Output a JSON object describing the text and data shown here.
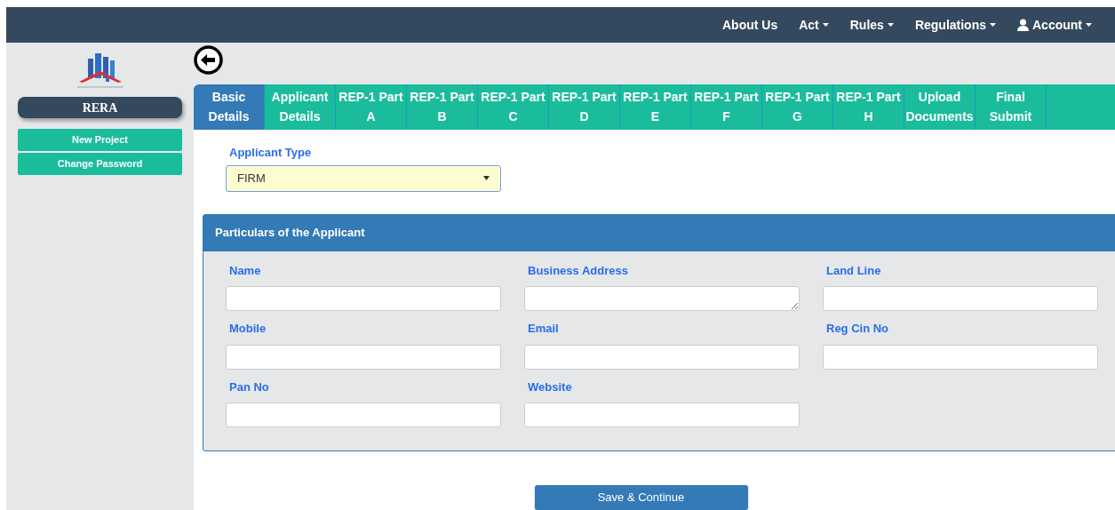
{
  "navbar": {
    "items": [
      {
        "label": "About Us",
        "dropdown": false,
        "kind": "link"
      },
      {
        "label": "Act",
        "dropdown": true,
        "kind": "link"
      },
      {
        "label": "Rules",
        "dropdown": true,
        "kind": "link"
      },
      {
        "label": "Regulations",
        "dropdown": true,
        "kind": "link"
      },
      {
        "label": "Account",
        "dropdown": true,
        "kind": "account"
      }
    ]
  },
  "sidebar": {
    "title": "RERA",
    "items": [
      {
        "label": "New Project"
      },
      {
        "label": "Change Password"
      }
    ]
  },
  "tabs": [
    {
      "line1": "Basic",
      "line2": "Details",
      "selected": true
    },
    {
      "line1": "Applicant",
      "line2": "Details",
      "selected": false
    },
    {
      "line1": "REP-1 Part",
      "line2": "A",
      "selected": false
    },
    {
      "line1": "REP-1 Part",
      "line2": "B",
      "selected": false
    },
    {
      "line1": "REP-1 Part",
      "line2": "C",
      "selected": false
    },
    {
      "line1": "REP-1 Part",
      "line2": "D",
      "selected": false
    },
    {
      "line1": "REP-1 Part",
      "line2": "E",
      "selected": false
    },
    {
      "line1": "REP-1 Part",
      "line2": "F",
      "selected": false
    },
    {
      "line1": "REP-1 Part",
      "line2": "G",
      "selected": false
    },
    {
      "line1": "REP-1 Part",
      "line2": "H",
      "selected": false
    },
    {
      "line1": "Upload",
      "line2": "Documents",
      "selected": false
    },
    {
      "line1": "Final",
      "line2": "Submit",
      "selected": false
    }
  ],
  "applicant_type": {
    "label": "Applicant Type",
    "value": "FIRM"
  },
  "panel": {
    "title": "Particulars of the Applicant",
    "fields": [
      {
        "label": "Name",
        "kind": "input"
      },
      {
        "label": "Business Address",
        "kind": "textarea"
      },
      {
        "label": "Land Line",
        "kind": "input"
      },
      {
        "label": "Mobile",
        "kind": "input"
      },
      {
        "label": "Email",
        "kind": "input"
      },
      {
        "label": "Reg Cin No",
        "kind": "input"
      },
      {
        "label": "Pan No",
        "kind": "input"
      },
      {
        "label": "Website",
        "kind": "input"
      }
    ]
  },
  "submit_button": "Save & Continue"
}
